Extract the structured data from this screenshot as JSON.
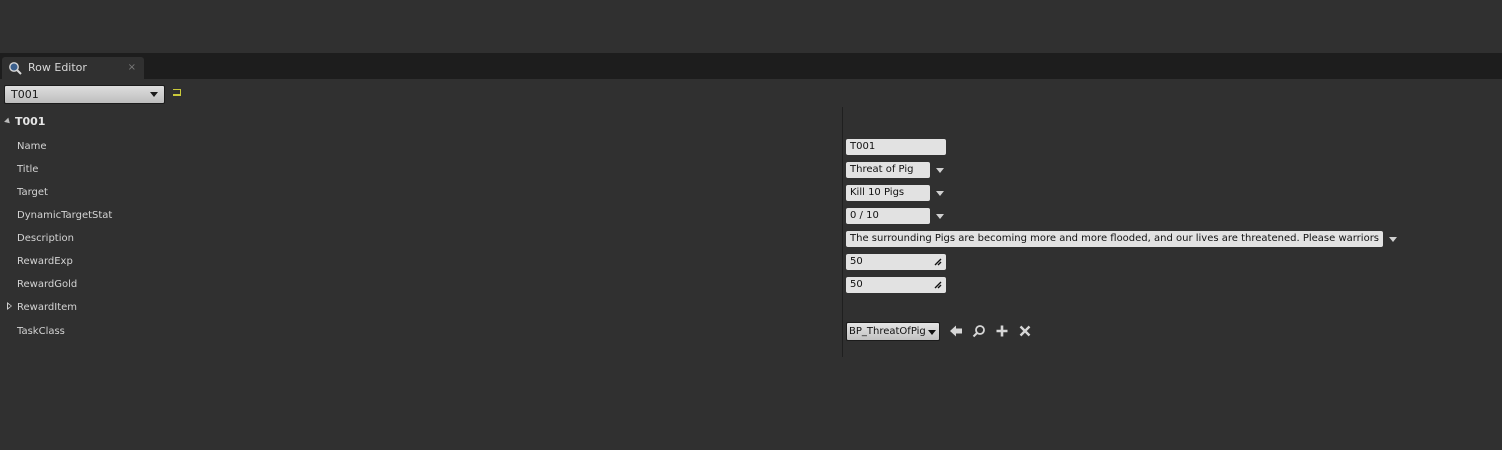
{
  "tab": {
    "label": "Row Editor",
    "close": "×",
    "icon": "magnifier-icon"
  },
  "row_selector": {
    "value": "T001"
  },
  "section": {
    "title": "T001"
  },
  "properties": [
    {
      "label": "Name",
      "value": "T001",
      "kind": "text"
    },
    {
      "label": "Title",
      "value": "Threat of Pig",
      "kind": "text-dropdown"
    },
    {
      "label": "Target",
      "value": "Kill 10 Pigs",
      "kind": "text-dropdown"
    },
    {
      "label": "DynamicTargetStat",
      "value": "0 / 10",
      "kind": "text-dropdown"
    },
    {
      "label": "Description",
      "value": "The surrounding Pigs are becoming more and more flooded, and our lives are threatened. Please warriors help us",
      "kind": "text-dropdown"
    },
    {
      "label": "RewardExp",
      "value": "50",
      "kind": "number"
    },
    {
      "label": "RewardGold",
      "value": "50",
      "kind": "number"
    },
    {
      "label": "RewardItem",
      "value": "",
      "kind": "array"
    },
    {
      "label": "TaskClass",
      "value": "BP_ThreatOfPig",
      "kind": "class"
    }
  ],
  "class_tools": [
    "use-selected-arrow-icon",
    "browse-search-icon",
    "add-plus-icon",
    "clear-x-icon"
  ],
  "colors": {
    "bg": "#303030",
    "tabbar": "#1d1d1d",
    "field": "#e2e2e2",
    "accent": "#c9c93a"
  }
}
